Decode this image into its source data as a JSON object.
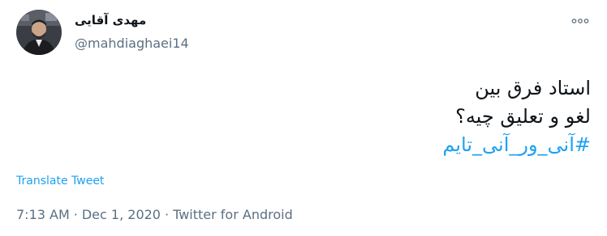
{
  "tweet": {
    "author": {
      "display_name": "مهدی آقایی",
      "handle": "@mahdiaghaei14",
      "avatar_icon": "user-avatar"
    },
    "more_icon": "more-horizontal-icon",
    "text_lines": [
      "استاد فرق بین",
      "لغو و تعلیق چیه؟"
    ],
    "hashtag": "#آنی_ور_آنی_تایم",
    "translate_label": "Translate Tweet",
    "meta": {
      "time": "7:13 AM",
      "separator": "·",
      "date": "Dec 1, 2020",
      "source": "Twitter for Android"
    },
    "colors": {
      "link": "#1da1f2",
      "secondary_text": "#5b7083",
      "primary_text": "#0f1419"
    }
  }
}
